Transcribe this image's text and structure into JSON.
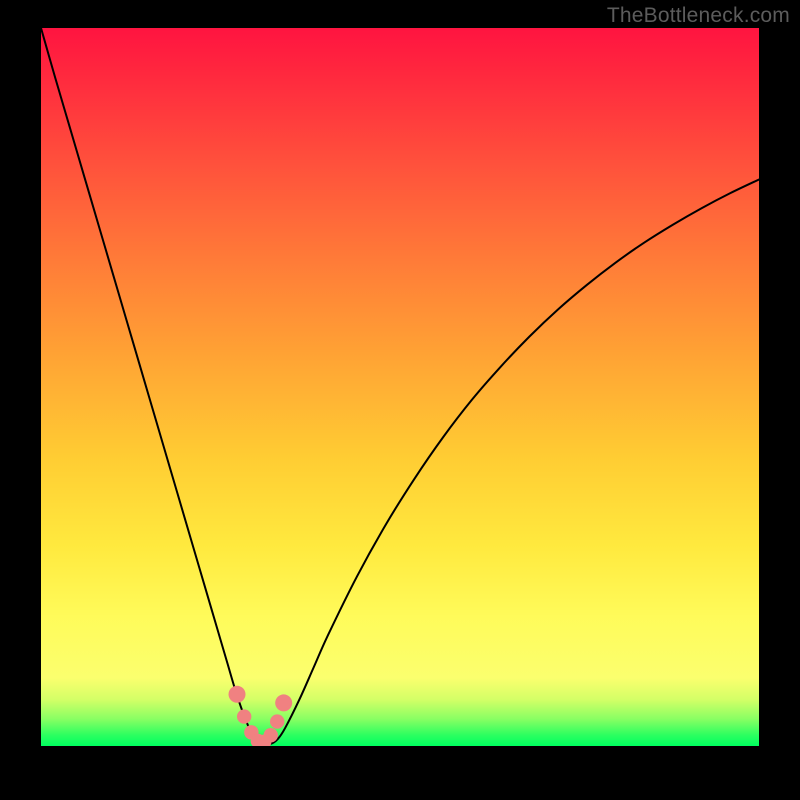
{
  "watermark": "TheBottleneck.com",
  "colors": {
    "frame": "#000000",
    "gradient_top": "#ff1440",
    "gradient_mid1": "#ff6e3a",
    "gradient_mid2": "#ffd233",
    "gradient_mid3": "#fff95a",
    "gradient_bottom": "#00ff5f",
    "curve": "#000000",
    "markers_fill": "#f08181",
    "markers_stroke": "#d45a5a"
  },
  "chart_data": {
    "type": "line",
    "title": "",
    "xlabel": "",
    "ylabel": "",
    "xlim": [
      0,
      100
    ],
    "ylim": [
      0,
      100
    ],
    "series": [
      {
        "name": "bottleneck-curve",
        "x": [
          0,
          2,
          4,
          6,
          8,
          10,
          12,
          14,
          16,
          18,
          20,
          22,
          24,
          25,
          26,
          27,
          28,
          29,
          30,
          31,
          32,
          33,
          34,
          36,
          38,
          40,
          44,
          48,
          52,
          56,
          60,
          64,
          68,
          72,
          76,
          80,
          84,
          88,
          92,
          96,
          100
        ],
        "y": [
          100,
          93,
          86.2,
          79.4,
          72.6,
          65.8,
          59,
          52.2,
          45.4,
          38.6,
          31.8,
          25,
          18.2,
          14.8,
          11.4,
          8,
          5,
          2.5,
          1,
          0.3,
          0.3,
          1,
          2.5,
          6.5,
          11,
          15.5,
          23.6,
          30.8,
          37.2,
          43,
          48.2,
          52.8,
          57,
          60.8,
          64.2,
          67.3,
          70.1,
          72.6,
          74.9,
          77,
          78.9
        ]
      }
    ],
    "markers": {
      "name": "highlight-points",
      "x": [
        27.3,
        28.3,
        29.3,
        30.2,
        31.1,
        32,
        32.9,
        33.8
      ],
      "y": [
        7.2,
        4.1,
        1.9,
        0.7,
        0.6,
        1.5,
        3.4,
        6
      ]
    }
  }
}
